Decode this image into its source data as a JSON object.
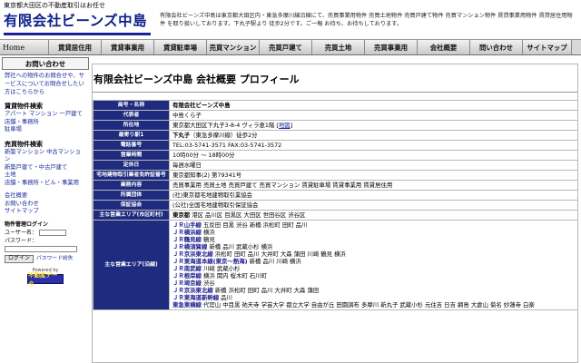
{
  "header": {
    "tagline": "東京都大田区の不動産取引はお任せ",
    "logo": "有限会社ビーンズ中島",
    "description": "有限会社ビーンズ中島は東京都大田区内・東急多摩川線沿線にて、売買事業用物件 売買土地物件 売買戸建て物件 売買マンション物件 賃貸事業用物件 賃貸居住用物件 を取り扱いしております。下丸子駅より 徒歩2分です。ご一報 お待ち、お待ちしております。"
  },
  "nav": [
    {
      "label": "Home"
    },
    {
      "label": "賃貸居住用"
    },
    {
      "label": "賃貸事業用"
    },
    {
      "label": "賃貸駐車場"
    },
    {
      "label": "売買マンション"
    },
    {
      "label": "売買戸建て"
    },
    {
      "label": "売買土地"
    },
    {
      "label": "売買事業用"
    },
    {
      "label": "会社概要"
    },
    {
      "label": "問い合わせ"
    },
    {
      "label": "サイトマップ"
    }
  ],
  "sidebar": {
    "contact_heading": "お問い合わせ",
    "contact_text": "弊社への物件のお問合せや、サービスについてお問合せしたい方はこちらから",
    "rental_title": "賃貸物件検索",
    "rental_links": [
      "アパート マンション 一戸建て",
      "店舗・事務所",
      "駐車場"
    ],
    "sale_title": "売買物件検索",
    "sale_links": [
      "新築マンション 中古マンション",
      "新築戸建て・中古戸建て",
      "土地",
      "店舗・事務所・ビル・事業用"
    ],
    "misc_links": [
      "会社概要",
      "お問い合わせ",
      "サイトマップ"
    ],
    "login": {
      "title": "物件管理ログイン",
      "user_label": "ユーザー名：",
      "password_label": "パスワード：",
      "button": "ログイン",
      "forgot": "パスワード紛失"
    },
    "powered_by": "Powered by",
    "powered_logo": "不動産データ"
  },
  "main": {
    "title": "有限会社ビーンズ中島 会社概要 プロフィール",
    "rows": [
      {
        "label": "商号・名称",
        "value": "有限会社ビーンズ中島",
        "strong": true
      },
      {
        "label": "代表者",
        "value": "中島くら子"
      },
      {
        "label": "所在地",
        "value": "東京都大田区下丸子3-8-4 ヴィラ恵1階 [",
        "link": "地図",
        "suffix": "]"
      },
      {
        "label": "最寄り駅1",
        "value_strong": "下丸子",
        "value": "（東急多摩川線）徒歩2分"
      },
      {
        "label": "電話番号",
        "value": "TEL:03-5741-3571 FAX:03-5741-3572"
      },
      {
        "label": "営業時間",
        "value": "10時00分 ～ 18時00分"
      },
      {
        "label": "定休日",
        "value": "毎週水曜日"
      },
      {
        "label": "宅地建物取引業者免許証番号",
        "value": "東京都知事(2) 第79341号"
      },
      {
        "label": "業務内容",
        "value": "売買事業用 売買土地 売買戸建て 売買マンション 賃貸駐車場 賃貸事業用 賃貸居住用"
      },
      {
        "label": "所属団体",
        "value": "(社)東京都宅地建物取引業協会"
      },
      {
        "label": "保証協会",
        "value": "(公社)全国宅地建物取引保証協会"
      },
      {
        "label": "主な営業エリア(市区町村)",
        "value_strong": "東京都",
        "value": " 港区 品川区 目黒区 大田区 世田谷区 渋谷区"
      }
    ],
    "lines_label": "主な営業エリア(沿線)",
    "lines": [
      {
        "mark": "ＪＲ",
        "name": "山手線",
        "stations": "五反田 目黒 渋谷 新橋 浜松町 田町 品川"
      },
      {
        "mark": "ＪＲ",
        "name": "横浜線",
        "stations": "横浜"
      },
      {
        "mark": "ＪＲ",
        "name": "鶴見線",
        "stations": "鶴見"
      },
      {
        "mark": "ＪＲ",
        "name": "横須賀線",
        "stations": "新橋 品川 武蔵小杉 横浜"
      },
      {
        "mark": "ＪＲ",
        "name": "京浜東北線",
        "stations": "浜松町 田町 品川 大井町 大森 蒲田 川崎 鶴見 横浜"
      },
      {
        "mark": "ＪＲ",
        "name": "東海道本線(東京～熱海)",
        "stations": "新橋 品川 川崎 横浜"
      },
      {
        "mark": "ＪＲ",
        "name": "南武線",
        "stations": "川崎 武蔵小杉"
      },
      {
        "mark": "ＪＲ",
        "name": "根岸線",
        "stations": "横浜 関内 桜木町 石川町"
      },
      {
        "mark": "ＪＲ",
        "name": "埼京線",
        "stations": "渋谷"
      },
      {
        "mark": "ＪＲ",
        "name": "京浜東北線",
        "stations": "新橋 浜松町 田町 品川 大井町 大森 蒲田"
      },
      {
        "mark": "ＪＲ",
        "name": "東海道新幹線",
        "stations": "品川"
      },
      {
        "mark": "",
        "name": "東急東横線",
        "stations": "代官山 中目黒 祐天寺 学芸大学 都立大学 自由が丘 田園調布 多摩川 新丸子 武蔵小杉 元住吉 日吉 綱島 大倉山 菊名 妙蓮寺 白楽"
      }
    ]
  }
}
